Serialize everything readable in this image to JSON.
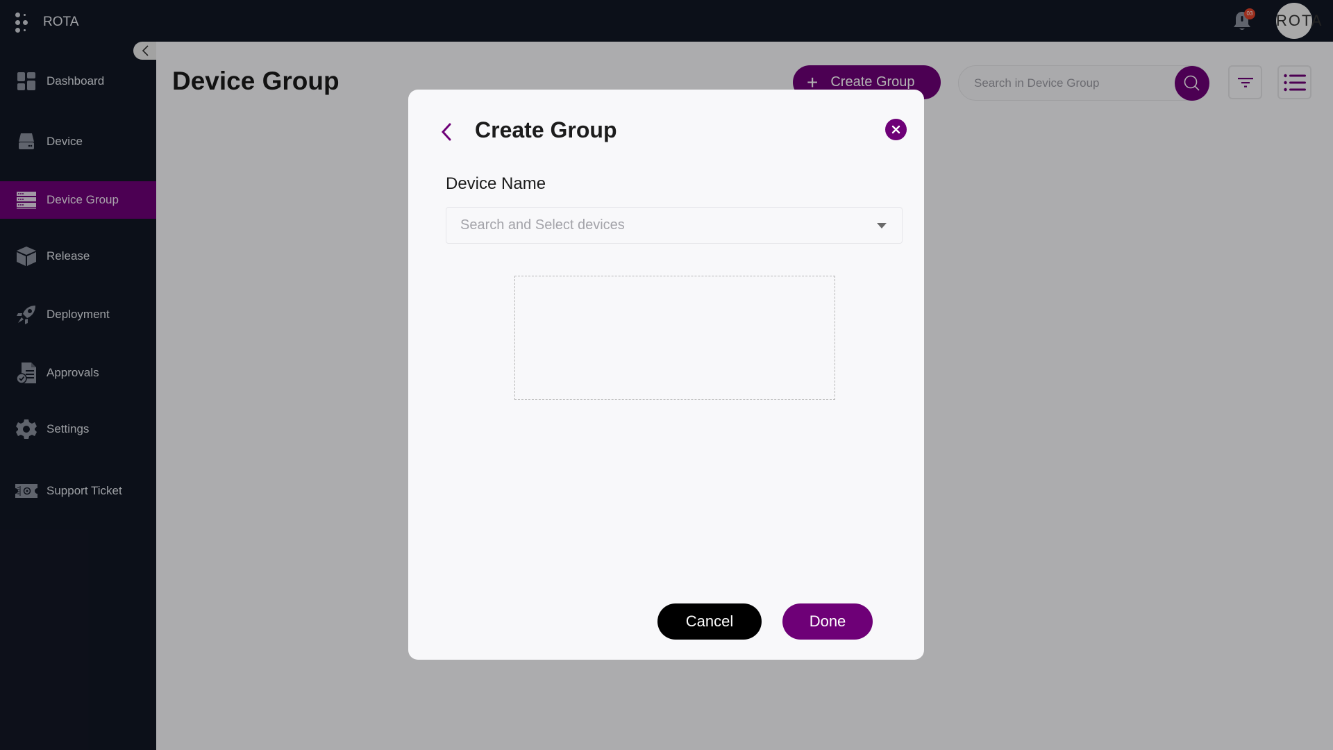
{
  "app": {
    "brand": "ROTA",
    "notification_count": "03",
    "avatar_text": "ROTA"
  },
  "sidebar": {
    "items": [
      {
        "label": "Dashboard",
        "icon": "dashboard-icon",
        "active": false
      },
      {
        "label": "Device",
        "icon": "device-icon",
        "active": false
      },
      {
        "label": "Device Group",
        "icon": "device-group-icon",
        "active": true
      },
      {
        "label": "Release",
        "icon": "box-icon",
        "active": false
      },
      {
        "label": "Deployment",
        "icon": "rocket-icon",
        "active": false
      },
      {
        "label": "Approvals",
        "icon": "approvals-icon",
        "active": false
      },
      {
        "label": "Settings",
        "icon": "gear-icon",
        "active": false
      },
      {
        "label": "Support Ticket",
        "icon": "ticket-icon",
        "active": false
      }
    ]
  },
  "page": {
    "title": "Device Group",
    "create_button": "Create Group",
    "search_placeholder": "Search in Device Group",
    "search_value": ""
  },
  "modal": {
    "title": "Create Group",
    "field_label": "Device Name",
    "dropdown_placeholder": "Search and Select devices",
    "dropdown_value": "",
    "cancel_label": "Cancel",
    "done_label": "Done"
  },
  "colors": {
    "accent": "#6e0077",
    "sidebar_bg": "#121725",
    "badge": "#e0432a"
  }
}
